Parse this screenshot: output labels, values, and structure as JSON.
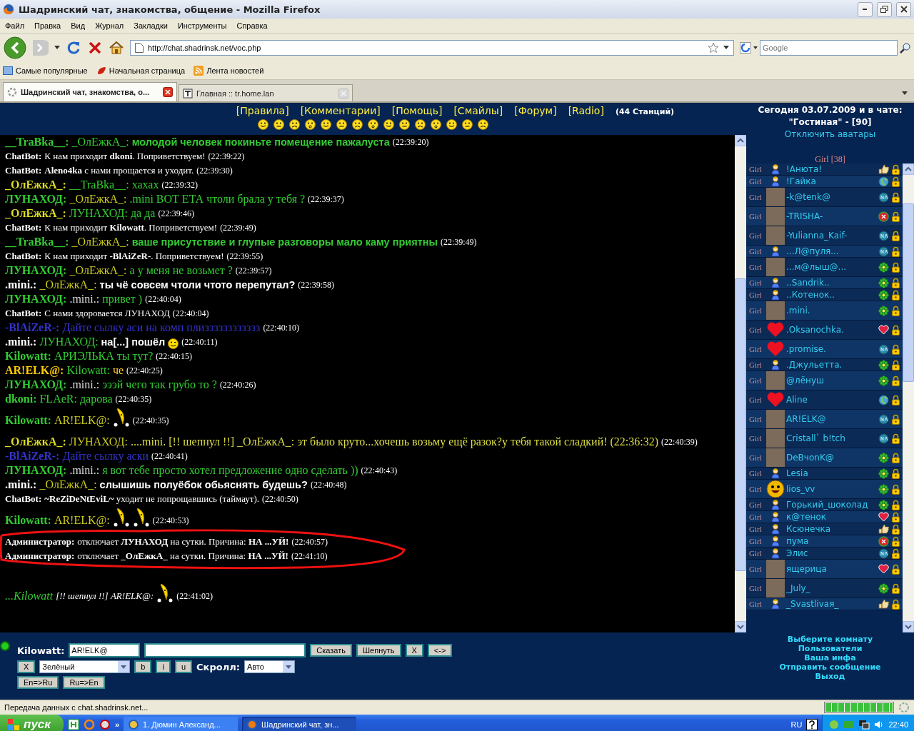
{
  "window": {
    "title": "Шадринский чат, знакомства, общение - Mozilla Firefox"
  },
  "menu": [
    "Файл",
    "Правка",
    "Вид",
    "Журнал",
    "Закладки",
    "Инструменты",
    "Справка"
  ],
  "address_bar": {
    "url": "http://chat.shadrinsk.net/voc.php"
  },
  "search": {
    "placeholder": "Google"
  },
  "bookmarks": [
    "Самые популярные",
    "Начальная страница",
    "Лента новостей"
  ],
  "tabs": [
    {
      "label": "Шадринский чат, знакомства, о...",
      "selected": true
    },
    {
      "label": "Главная :: tr.home.lan",
      "selected": false
    }
  ],
  "nav_links": [
    "[Правила]",
    "[Комментарии]",
    "[Помощь]",
    "[Смайлы]",
    "[Форум]",
    "[Radio]"
  ],
  "radio_note": "(44 Станций)",
  "messages": [
    {
      "kind": "user",
      "author": {
        "name": "__TraBka__:",
        "color": "#33cc33"
      },
      "to": {
        "name": "_ОлЕжкА_:",
        "color": "#33cc33"
      },
      "text": "**молодой человек покиньте помещение пажалуста**",
      "color": "#33cc33",
      "time": "(22:39:20)"
    },
    {
      "kind": "bot",
      "author": {
        "name": "ChatBot:"
      },
      "text": "К нам приходит **dkoni**. Поприветствуем!",
      "time": "(22:39:22)"
    },
    {
      "kind": "bot",
      "author": {
        "name": "ChatBot:"
      },
      "text": "**Aleno4ka** с нами прощается и уходит.",
      "time": "(22:39:30)"
    },
    {
      "kind": "user",
      "author": {
        "name": "_ОлЕжкА_:",
        "color": "#dddd22"
      },
      "to": {
        "name": "__TraBka__:",
        "color": "#33cc33"
      },
      "text": "хахах",
      "color": "#33cc33",
      "time": "(22:39:32)"
    },
    {
      "kind": "user",
      "author": {
        "name": "ЛУНАХОД:",
        "color": "#33cc33"
      },
      "to": {
        "name": "_ОлЕжкА_:",
        "color": "#cccc22"
      },
      "text": ".mini ВОТ ЕТА чтоли брала у тебя ?",
      "color": "#33cc33",
      "time": "(22:39:37)"
    },
    {
      "kind": "user",
      "author": {
        "name": "_ОлЕжкА_:",
        "color": "#dddd22"
      },
      "to": {
        "name": "ЛУНАХОД:",
        "color": "#33cc33"
      },
      "text": "да да",
      "color": "#33cc33",
      "time": "(22:39:46)"
    },
    {
      "kind": "bot",
      "author": {
        "name": "ChatBot:"
      },
      "text": "К нам приходит **Kilowatt**. Поприветствуем!",
      "time": "(22:39:49)"
    },
    {
      "kind": "user",
      "author": {
        "name": "__TraBka__:",
        "color": "#33cc33"
      },
      "to": {
        "name": "_ОлЕжкА_:",
        "color": "#cccc22"
      },
      "text": "**ваше присутствие и глупые разговоры мало каму приятны**",
      "color": "#33cc33",
      "time": "(22:39:49)"
    },
    {
      "kind": "bot",
      "author": {
        "name": "ChatBot:"
      },
      "text": "К нам приходит **-BlAiZeR-**. Поприветствуем!",
      "time": "(22:39:55)"
    },
    {
      "kind": "user",
      "author": {
        "name": "ЛУНАХОД:",
        "color": "#33cc33"
      },
      "to": {
        "name": "_ОлЕжкА_:",
        "color": "#cccc22"
      },
      "text": "а у меня не возьмет ?",
      "color": "#33cc33",
      "time": "(22:39:57)"
    },
    {
      "kind": "user",
      "author": {
        "name": ".mini.:",
        "color": "#ffffff"
      },
      "to": {
        "name": "_ОлЕжкА_:",
        "color": "#cccc22"
      },
      "text": "**ты чё совсем чтоли чтото перепутал?**",
      "color": "#ffffff",
      "time": "(22:39:58)"
    },
    {
      "kind": "user",
      "author": {
        "name": "ЛУНАХОД:",
        "color": "#33cc33"
      },
      "to": {
        "name": ".mini.:",
        "color": "#dddddd"
      },
      "text": "привет )",
      "color": "#33cc33",
      "time": "(22:40:04)"
    },
    {
      "kind": "bot",
      "author": {
        "name": "ChatBot:"
      },
      "text": "С нами здоровается ЛУНАХОД",
      "time": "(22:40:04)"
    },
    {
      "kind": "user",
      "author": {
        "name": "-BlAiZeR-:",
        "color": "#3333cc"
      },
      "text": "Дайте сылку аси на комп плизззззззззззз",
      "color": "#3333cc",
      "time": "(22:40:10)"
    },
    {
      "kind": "user",
      "author": {
        "name": ".mini.:",
        "color": "#ffffff"
      },
      "to": {
        "name": "ЛУНАХОД:",
        "color": "#33cc33"
      },
      "text": "**на[...] пошёл**",
      "color": "#ffffff",
      "icons": [
        {
          "kind": "wink"
        }
      ],
      "time": "(22:40:11)"
    },
    {
      "kind": "user",
      "author": {
        "name": "Kilowatt:",
        "color": "#33cc33"
      },
      "text": "АРИЭЛЬКА ты тут?",
      "color": "#33cc33",
      "time": "(22:40:15)"
    },
    {
      "kind": "user",
      "author": {
        "name": "AR!ELK@:",
        "color": "#ffcc00"
      },
      "to": {
        "name": "Kilowatt:",
        "color": "#33cc33"
      },
      "text": "че",
      "color": "#ffcc33",
      "time": "(22:40:25)"
    },
    {
      "kind": "user",
      "author": {
        "name": "ЛУНАХОД:",
        "color": "#33cc33"
      },
      "to": {
        "name": ".mini.:",
        "color": "#dddddd"
      },
      "text": "эээй чего так грубо то ?",
      "color": "#33cc33",
      "time": "(22:40:26)"
    },
    {
      "kind": "user",
      "author": {
        "name": "dkoni:",
        "color": "#33cc33"
      },
      "to": {
        "name": "FLAeR:",
        "color": "#33cc33"
      },
      "text": "дарова",
      "color": "#33cc33",
      "time": "(22:40:35)"
    },
    {
      "kind": "user",
      "author": {
        "name": "Kilowatt:",
        "color": "#33cc33"
      },
      "to": {
        "name": "AR!ELK@:",
        "color": "#cccc22"
      },
      "icons": [
        {
          "kind": "banana"
        }
      ],
      "time": "(22:40:35)"
    },
    {
      "kind": "user",
      "author": {
        "name": "_ОлЕжкА_:",
        "color": "#dddd22"
      },
      "to": {
        "name": "ЛУНАХОД:",
        "color": "#cccc22"
      },
      "text": "....mini. [!! шепнул !!] _ОлЕжкА_: эт было круто...хочешь возьму ещё разок?у тебя такой сладкий! (22:36:32)",
      "color": "#dddd44",
      "time": "(22:40:39)"
    },
    {
      "kind": "user",
      "author": {
        "name": "-BlAiZeR-:",
        "color": "#3333cc"
      },
      "text": "Дайте сылку аски",
      "color": "#3333cc",
      "time": "(22:40:41)"
    },
    {
      "kind": "user",
      "author": {
        "name": "ЛУНАХОД:",
        "color": "#33cc33"
      },
      "to": {
        "name": ".mini.:",
        "color": "#dddddd"
      },
      "text": "я вот тебе просто хотел предложение одно сделать ))",
      "color": "#33cc33",
      "time": "(22:40:43)"
    },
    {
      "kind": "user",
      "author": {
        "name": ".mini.:",
        "color": "#ffffff"
      },
      "to": {
        "name": "_ОлЕжкА_:",
        "color": "#cccc22"
      },
      "text": "**слышишь полуёбок обьяснять будешь?**",
      "color": "#ffffff",
      "time": "(22:40:48)"
    },
    {
      "kind": "bot",
      "author": {
        "name": "ChatBot:"
      },
      "text": "**~ReZiDeNtEviL~** уходит не попрощавшись (таймаут).",
      "time": "(22:40:50)"
    },
    {
      "kind": "user",
      "author": {
        "name": "Kilowatt:",
        "color": "#33cc33"
      },
      "to": {
        "name": "AR!ELK@:",
        "color": "#cccc22"
      },
      "icons": [
        {
          "kind": "banana"
        },
        {
          "kind": "banana"
        }
      ],
      "time": "(22:40:53)"
    },
    {
      "kind": "bot",
      "author": {
        "name": "Администратор:"
      },
      "text": "отключает **ЛУНАХОД** на сутки. Причина: **НА ...УЙ!**",
      "time": "(22:40:57)"
    },
    {
      "kind": "bot",
      "author": {
        "name": "Администратор:"
      },
      "text": "отключает **_ОлЕжкА_** на сутки. Причина: **НА ...УЙ!**",
      "time": "(22:41:10)"
    },
    {
      "kind": "whisper",
      "author": {
        "name": "...Kilowatt",
        "color": "#33cc33"
      },
      "text": "[!! шепнул !!] AR!ELK@:",
      "color": "#ffffff",
      "icons": [
        {
          "kind": "banana"
        }
      ],
      "time": "(22:41:02)"
    }
  ],
  "sidebar": {
    "date_line": "Сегодня 03.07.2009 и в чате:",
    "room": "\"Гостиная\" - [90]",
    "avatars_link": "Отключить аватары",
    "group": "Girl [38]",
    "users": [
      {
        "label": "Girl",
        "avatar": {
          "kind": "figure"
        },
        "name": "!Анюта!",
        "status": {
          "kind": "thumb"
        }
      },
      {
        "label": "Girl",
        "avatar": {
          "kind": "figure"
        },
        "name": "!Гайка",
        "status": {
          "kind": "globe"
        }
      },
      {
        "label": "Girl",
        "avatar": {
          "kind": "photo"
        },
        "name": "-k@tenk@",
        "status": {
          "kind": "na"
        }
      },
      {
        "label": "Girl",
        "avatar": {
          "kind": "photo"
        },
        "name": "-TRISHA-",
        "status": {
          "kind": "busy"
        }
      },
      {
        "label": "Girl",
        "avatar": {
          "kind": "photo"
        },
        "name": "-Yulianna_Kaif-",
        "status": {
          "kind": "na"
        }
      },
      {
        "label": "Girl",
        "avatar": {
          "kind": "figure"
        },
        "name": "...Л@пуля...",
        "status": {
          "kind": "na"
        }
      },
      {
        "label": "Girl",
        "avatar": {
          "kind": "photo"
        },
        "name": "...м@лыш@...",
        "status": {
          "kind": "online"
        }
      },
      {
        "label": "Girl",
        "avatar": {
          "kind": "figure"
        },
        "name": "..Sandrik..",
        "status": {
          "kind": "online"
        }
      },
      {
        "label": "Girl",
        "avatar": {
          "kind": "figure"
        },
        "name": "..Котенок..",
        "status": {
          "kind": "online"
        }
      },
      {
        "label": "Girl",
        "avatar": {
          "kind": "photo"
        },
        "name": ".mini.",
        "status": {
          "kind": "online"
        }
      },
      {
        "label": "Girl",
        "avatar": {
          "kind": "heart"
        },
        "name": ".Oksanochka.",
        "status": {
          "kind": "heart"
        }
      },
      {
        "label": "Girl",
        "avatar": {
          "kind": "heart"
        },
        "name": ".promise.",
        "status": {
          "kind": "na"
        }
      },
      {
        "label": "Girl",
        "avatar": {
          "kind": "figure"
        },
        "name": ".Джульетта.",
        "status": {
          "kind": "online"
        }
      },
      {
        "label": "Girl",
        "avatar": {
          "kind": "photo"
        },
        "name": "@лёнуш",
        "status": {
          "kind": "online"
        }
      },
      {
        "label": "Girl",
        "avatar": {
          "kind": "heart"
        },
        "name": "Aline",
        "status": {
          "kind": "globe"
        }
      },
      {
        "label": "Girl",
        "avatar": {
          "kind": "photo"
        },
        "name": "AR!ELK@",
        "status": {
          "kind": "na"
        }
      },
      {
        "label": "Girl",
        "avatar": {
          "kind": "photo"
        },
        "name": "Cristall` b!tch",
        "status": {
          "kind": "na"
        }
      },
      {
        "label": "Girl",
        "avatar": {
          "kind": "photo"
        },
        "name": "DeBчonK@",
        "status": {
          "kind": "online"
        }
      },
      {
        "label": "Girl",
        "avatar": {
          "kind": "figure"
        },
        "name": "Lesia",
        "status": {
          "kind": "online"
        }
      },
      {
        "label": "Girl",
        "avatar": {
          "kind": "smiley"
        },
        "name": "lios_vv",
        "status": {
          "kind": "online"
        }
      },
      {
        "label": "Girl",
        "avatar": {
          "kind": "figure"
        },
        "name": "Горький_шоколад",
        "status": {
          "kind": "online"
        }
      },
      {
        "label": "Girl",
        "avatar": {
          "kind": "figure"
        },
        "name": "к@тенок",
        "status": {
          "kind": "heart"
        }
      },
      {
        "label": "Girl",
        "avatar": {
          "kind": "figure"
        },
        "name": "Ксюнечка",
        "status": {
          "kind": "thumb"
        }
      },
      {
        "label": "Girl",
        "avatar": {
          "kind": "figure"
        },
        "name": "пума",
        "status": {
          "kind": "busy"
        }
      },
      {
        "label": "Girl",
        "avatar": {
          "kind": "figure"
        },
        "name": "Элис",
        "status": {
          "kind": "na"
        }
      },
      {
        "label": "Girl",
        "avatar": {
          "kind": "photo"
        },
        "name": "ящерица",
        "status": {
          "kind": "heart"
        }
      },
      {
        "label": "Girl",
        "avatar": {
          "kind": "photo"
        },
        "name": "_July_",
        "status": {
          "kind": "online"
        }
      },
      {
        "label": "Girl",
        "avatar": {
          "kind": "figure"
        },
        "name": "_Svastlivaя_",
        "status": {
          "kind": "thumb"
        }
      }
    ]
  },
  "composer": {
    "online": true,
    "nick_label": "Kilowatt:",
    "recipient": "AR!ELK@",
    "buttons": [
      "Сказать",
      "Шепнуть",
      "X",
      "<->"
    ],
    "clear_button": "X",
    "color_select": "Зелёный",
    "format_buttons": [
      "b",
      "i",
      "u"
    ],
    "scroll_label": "Скролл:",
    "scroll_select": "Авто",
    "translit_buttons": [
      "En=>Ru",
      "Ru=>En"
    ]
  },
  "room_menu": [
    "Выберите комнату",
    "Пользователи",
    "Ваша инфа",
    "Отправить сообщение",
    "Выход"
  ],
  "status_bar": {
    "text": "Передача данных с chat.shadrinsk.net...",
    "level": 1
  },
  "taskbar": {
    "start": "пуск",
    "quick_more": "»",
    "tasks": [
      {
        "label": "1. Дюмин Александ...",
        "selected": false
      },
      {
        "label": "Шадринский чат, зн...",
        "selected": true
      }
    ],
    "language": "RU",
    "clock": "22:40"
  }
}
